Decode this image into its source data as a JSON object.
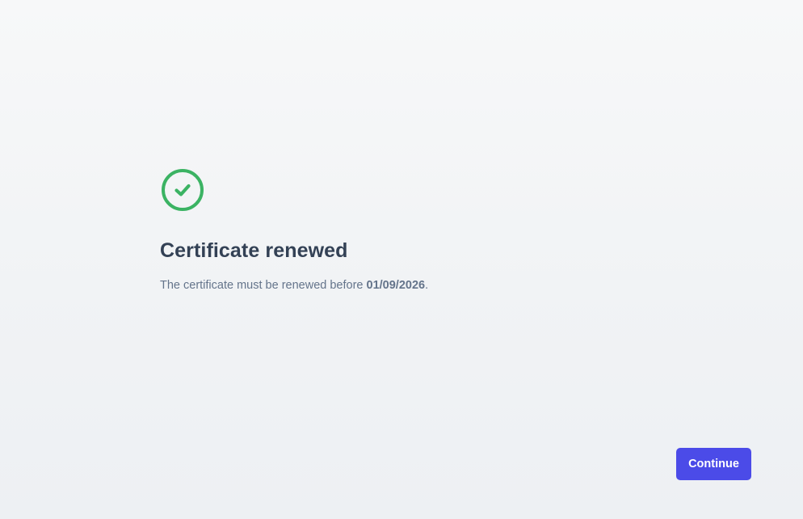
{
  "status": {
    "icon": "check-circle-icon",
    "color": "#3bb363"
  },
  "title": "Certificate renewed",
  "message": {
    "prefix": "The certificate must be renewed before ",
    "date": "01/09/2026",
    "suffix": "."
  },
  "actions": {
    "continue_label": "Continue",
    "accent_color": "#4b4be8"
  }
}
